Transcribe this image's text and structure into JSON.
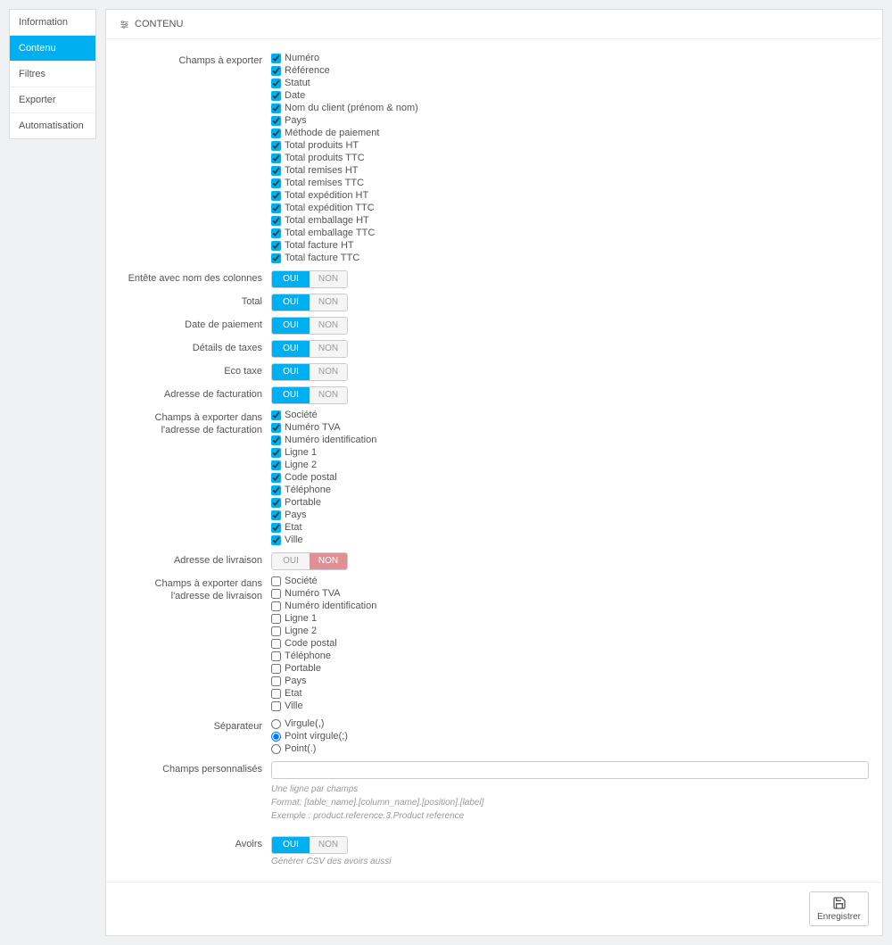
{
  "sidebar": {
    "items": [
      {
        "label": "Information"
      },
      {
        "label": "Contenu"
      },
      {
        "label": "Filtres"
      },
      {
        "label": "Exporter"
      },
      {
        "label": "Automatisation"
      }
    ]
  },
  "panel": {
    "title": "CONTENU"
  },
  "fields": {
    "export_label": "Champs à exporter",
    "export_items": [
      "Numéro",
      "Référence",
      "Statut",
      "Date",
      "Nom du client (prénom & nom)",
      "Pays",
      "Méthode de paiement",
      "Total produits HT",
      "Total produits TTC",
      "Total remises HT",
      "Total remises TTC",
      "Total expédition HT",
      "Total expédition TTC",
      "Total emballage HT",
      "Total emballage TTC",
      "Total facture HT",
      "Total facture TTC"
    ],
    "header_label": "Entête avec nom des colonnes",
    "total_label": "Total",
    "payment_date_label": "Date de paiement",
    "tax_details_label": "Détails de taxes",
    "eco_tax_label": "Eco taxe",
    "billing_addr_label": "Adresse de facturation",
    "billing_fields_label": "Champs à exporter dans l'adresse de facturation",
    "billing_items": [
      "Société",
      "Numéro TVA",
      "Numéro identification",
      "Ligne 1",
      "Ligne 2",
      "Code postal",
      "Téléphone",
      "Portable",
      "Pays",
      "Etat",
      "Ville"
    ],
    "delivery_addr_label": "Adresse de livraison",
    "delivery_fields_label": "Champs à exporter dans l'adresse de livraison",
    "delivery_items": [
      "Société",
      "Numéro TVA",
      "Numéro identification",
      "Ligne 1",
      "Ligne 2",
      "Code postal",
      "Téléphone",
      "Portable",
      "Pays",
      "Etat",
      "Ville"
    ],
    "separator_label": "Séparateur",
    "separator_options": [
      "Virgule(,)",
      "Point virgule(;)",
      "Point(.)"
    ],
    "custom_fields_label": "Champs personnalisés",
    "custom_help1": "Une ligne par champs",
    "custom_help2": "Format: [table_name].[column_name].[position].[label]",
    "custom_help3": "Exemple : product.reference.3.Product reference",
    "credits_label": "Avoirs",
    "credits_help": "Générer CSV des avoirs aussi",
    "yes": "OUI",
    "no": "NON",
    "save": "Enregistrer"
  }
}
